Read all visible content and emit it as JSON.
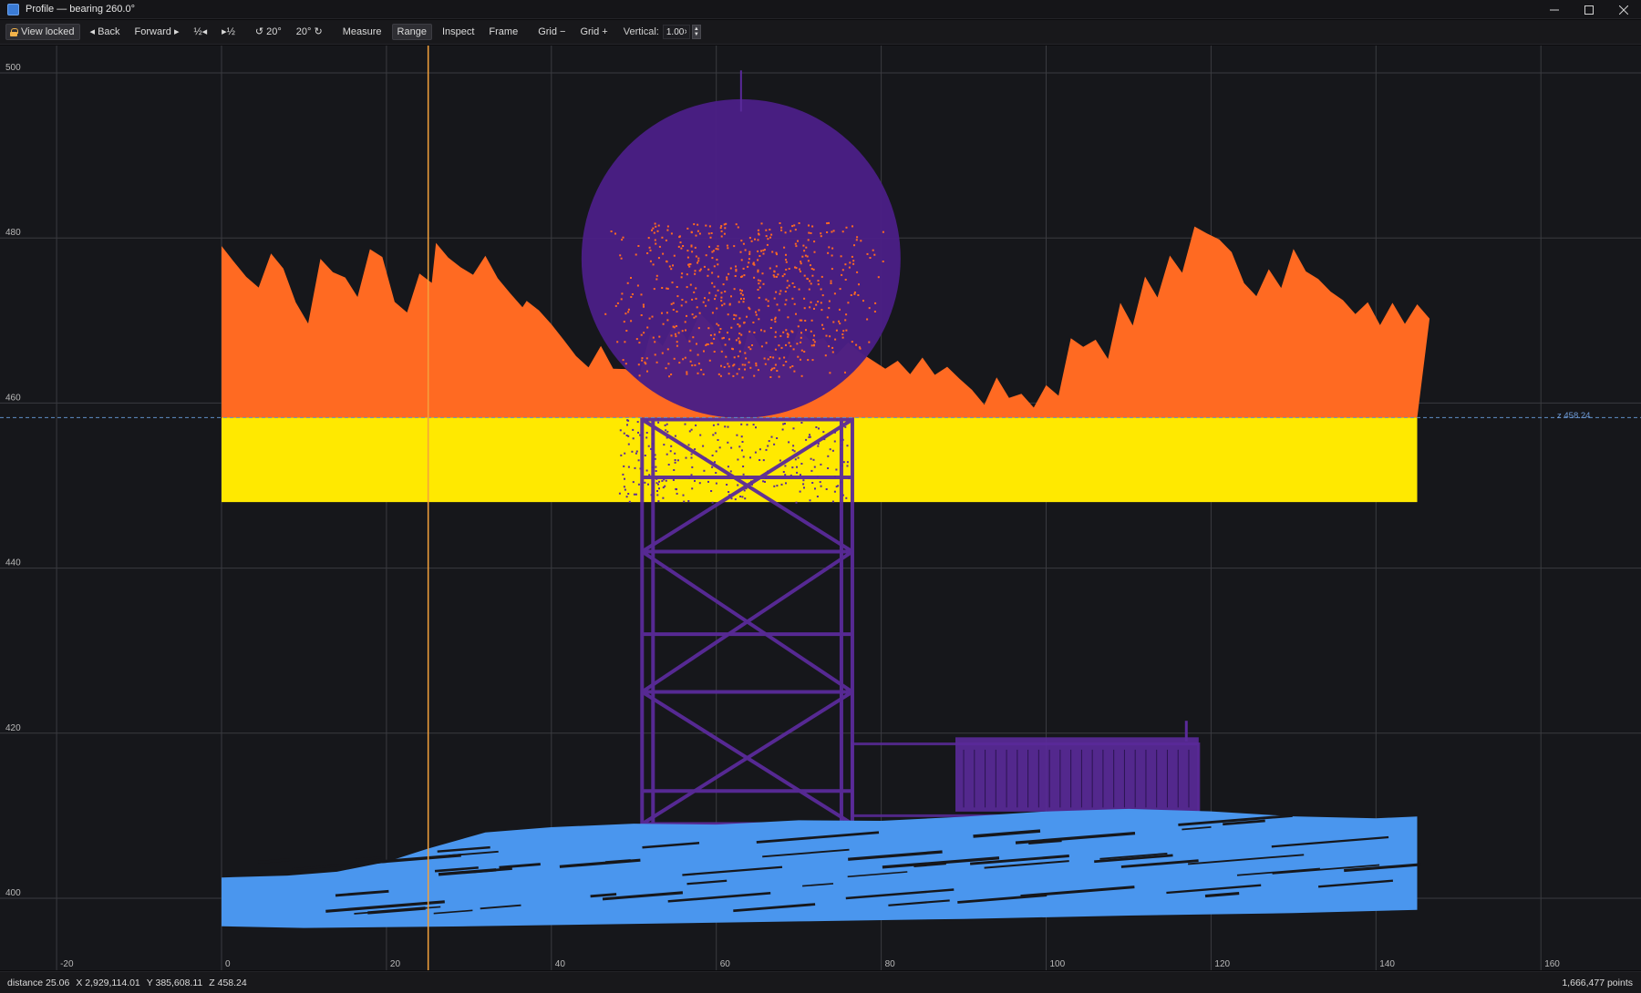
{
  "window": {
    "title": "Profile — bearing 260.0°"
  },
  "toolbar": {
    "view_locked": "View locked",
    "back": "◂ Back",
    "forward": "Forward ▸",
    "zoom_in": "½◂",
    "zoom_out": "▸½",
    "rotate_left": "↺ 20°",
    "rotate_right": "20° ↻",
    "measure": "Measure",
    "range": "Range",
    "inspect": "Inspect",
    "frame": "Frame",
    "grid_minus": "Grid −",
    "grid_plus": "Grid +",
    "vertical_label": "Vertical:",
    "vertical_value": "1.00×"
  },
  "profile": {
    "x_ticks": [
      "-20",
      "0",
      "20",
      "40",
      "60",
      "80",
      "100",
      "120",
      "140",
      "160"
    ],
    "y_ticks": [
      "500",
      "480",
      "460",
      "440",
      "420",
      "400"
    ],
    "cursor_distance": 25.06,
    "z_readout": "z 458.24",
    "range_band_z": [
      448,
      458.24
    ],
    "colors": {
      "background": "#16171b",
      "grid": "#3a3b40",
      "vegetation": "#ff6a22",
      "range_band": "#ffe900",
      "structure": "#5a2a9a",
      "dome": "#4a1f85",
      "ground": "#4a96ee",
      "cursor": "#f5a23c",
      "z_line": "#5f8fc8"
    }
  },
  "status": {
    "distance": "distance 25.06",
    "x": "X 2,929,114.01",
    "y": "Y 385,608.11",
    "z": "Z 458.24",
    "points": "1,666,477 points"
  }
}
